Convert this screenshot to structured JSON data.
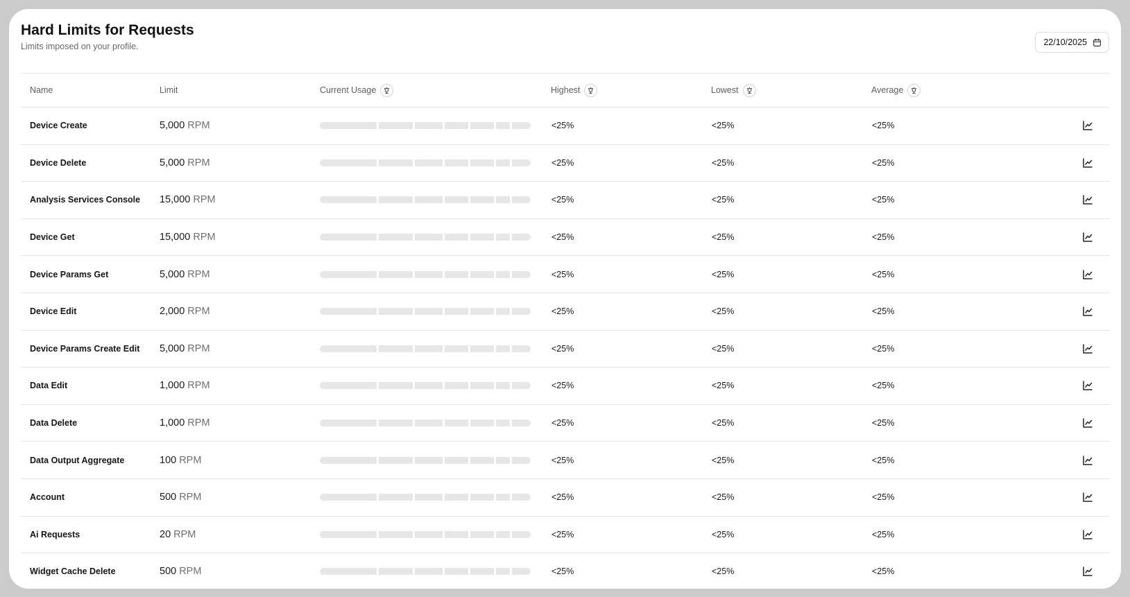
{
  "header": {
    "title": "Hard Limits for Requests",
    "subtitle": "Limits imposed on your profile.",
    "date": "22/10/2025"
  },
  "columns": {
    "name": "Name",
    "limit": "Limit",
    "current_usage": "Current Usage",
    "highest": "Highest",
    "lowest": "Lowest",
    "average": "Average"
  },
  "icons": {
    "calendar": "calendar-icon",
    "info": "info-icon",
    "chart": "line-chart-icon"
  },
  "colors": {
    "bar_segment": "#e7e7ea",
    "border": "#e6e6e6",
    "muted_text": "#6b6b6b"
  },
  "rows": [
    {
      "name": "Device Create",
      "limit": "5,000",
      "unit": "RPM",
      "highest": "<25%",
      "lowest": "<25%",
      "average": "<25%"
    },
    {
      "name": "Device Delete",
      "limit": "5,000",
      "unit": "RPM",
      "highest": "<25%",
      "lowest": "<25%",
      "average": "<25%"
    },
    {
      "name": "Analysis Services Console",
      "limit": "15,000",
      "unit": "RPM",
      "highest": "<25%",
      "lowest": "<25%",
      "average": "<25%"
    },
    {
      "name": "Device Get",
      "limit": "15,000",
      "unit": "RPM",
      "highest": "<25%",
      "lowest": "<25%",
      "average": "<25%"
    },
    {
      "name": "Device Params Get",
      "limit": "5,000",
      "unit": "RPM",
      "highest": "<25%",
      "lowest": "<25%",
      "average": "<25%"
    },
    {
      "name": "Device Edit",
      "limit": "2,000",
      "unit": "RPM",
      "highest": "<25%",
      "lowest": "<25%",
      "average": "<25%"
    },
    {
      "name": "Device Params Create Edit",
      "limit": "5,000",
      "unit": "RPM",
      "highest": "<25%",
      "lowest": "<25%",
      "average": "<25%"
    },
    {
      "name": "Data Edit",
      "limit": "1,000",
      "unit": "RPM",
      "highest": "<25%",
      "lowest": "<25%",
      "average": "<25%"
    },
    {
      "name": "Data Delete",
      "limit": "1,000",
      "unit": "RPM",
      "highest": "<25%",
      "lowest": "<25%",
      "average": "<25%"
    },
    {
      "name": "Data Output Aggregate",
      "limit": "100",
      "unit": "RPM",
      "highest": "<25%",
      "lowest": "<25%",
      "average": "<25%"
    },
    {
      "name": "Account",
      "limit": "500",
      "unit": "RPM",
      "highest": "<25%",
      "lowest": "<25%",
      "average": "<25%"
    },
    {
      "name": "Ai Requests",
      "limit": "20",
      "unit": "RPM",
      "highest": "<25%",
      "lowest": "<25%",
      "average": "<25%"
    },
    {
      "name": "Widget Cache Delete",
      "limit": "500",
      "unit": "RPM",
      "highest": "<25%",
      "lowest": "<25%",
      "average": "<25%"
    }
  ]
}
